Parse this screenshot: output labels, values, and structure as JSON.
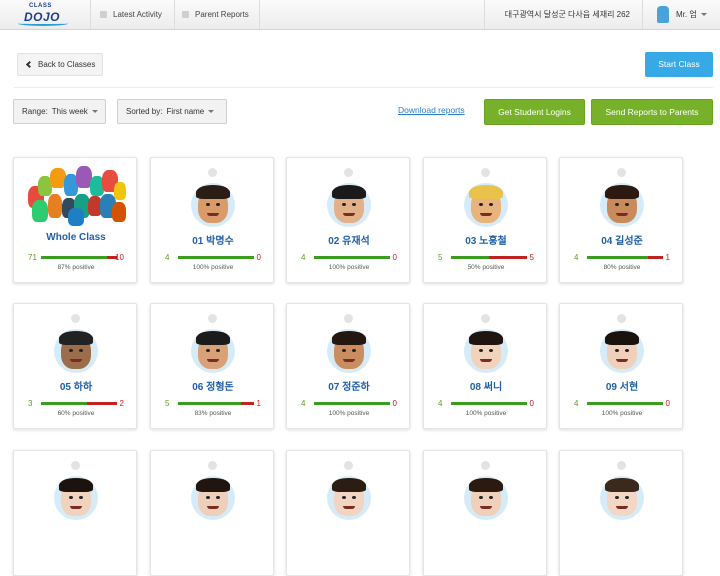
{
  "nav": {
    "logo_small": "CLASS",
    "logo_big": "DOJO",
    "latest_activity": "Latest Activity",
    "parent_reports": "Parent Reports",
    "school": "대구광역시 달성군 다사읍 세재리 262",
    "user": "Mr. 엄"
  },
  "toolbar": {
    "back_label": "Back to Classes",
    "start_label": "Start Class",
    "range_label": "Range:",
    "range_value": "This week",
    "sort_label": "Sorted by:",
    "sort_value": "First name",
    "download_label": "Download reports",
    "logins_label": "Get Student Logins",
    "send_label": "Send Reports to Parents"
  },
  "colors": {
    "positive": "#3c9c21",
    "negative": "#c0221f",
    "accent": "#37a9e6",
    "green_button": "#77b129"
  },
  "cards": [
    {
      "name": "Whole Class",
      "pos": "71",
      "neg": "10",
      "pct": "87% positive",
      "ratio": 0.87,
      "avatar": "monsters-icon"
    },
    {
      "name": "01 박명수",
      "pos": "4",
      "neg": "0",
      "pct": "100% positive",
      "ratio": 1.0,
      "avatar": "cartoon-face-icon"
    },
    {
      "name": "02 유재석",
      "pos": "4",
      "neg": "0",
      "pct": "100% positive",
      "ratio": 1.0,
      "avatar": "cartoon-face-icon"
    },
    {
      "name": "03 노홍철",
      "pos": "5",
      "neg": "5",
      "pct": "50% positive",
      "ratio": 0.5,
      "avatar": "cartoon-face-icon"
    },
    {
      "name": "04 길성준",
      "pos": "4",
      "neg": "1",
      "pct": "80% positive",
      "ratio": 0.8,
      "avatar": "cartoon-face-icon"
    },
    {
      "name": "05 하하",
      "pos": "3",
      "neg": "2",
      "pct": "60% positive",
      "ratio": 0.6,
      "avatar": "cartoon-face-icon"
    },
    {
      "name": "06 정형돈",
      "pos": "5",
      "neg": "1",
      "pct": "83% positive",
      "ratio": 0.83,
      "avatar": "cartoon-face-icon"
    },
    {
      "name": "07 정준하",
      "pos": "4",
      "neg": "0",
      "pct": "100% positive",
      "ratio": 1.0,
      "avatar": "cartoon-face-icon"
    },
    {
      "name": "08 써니",
      "pos": "4",
      "neg": "0",
      "pct": "100% positive",
      "ratio": 1.0,
      "avatar": "photo-face-icon"
    },
    {
      "name": "09 서현",
      "pos": "4",
      "neg": "0",
      "pct": "100% positive",
      "ratio": 1.0,
      "avatar": "photo-face-icon"
    }
  ]
}
